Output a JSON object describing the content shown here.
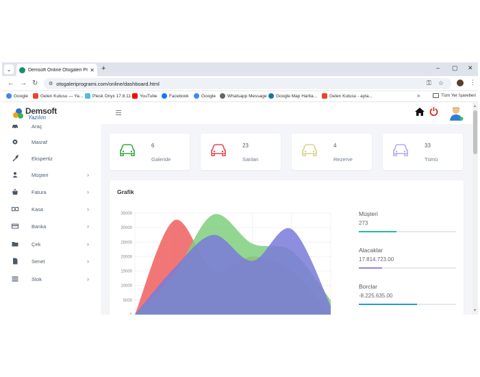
{
  "browser": {
    "tab_title": "Demsoft Online Otogaleri Programı",
    "new_tab": "+",
    "url": "otogaleriprogrami.com/online/dashboard.html",
    "minimize": "–",
    "restore": "▢",
    "close": "✕"
  },
  "bookmarks": [
    {
      "label": "Google",
      "icon": "google-icon",
      "color": "#4285f4"
    },
    {
      "label": "Gelen Kutusu — Ya...",
      "icon": "gmail-icon",
      "color": "#ea4335"
    },
    {
      "label": "Plesk Onyx 17.8.11",
      "icon": "plesk-icon",
      "color": "#52bbe6"
    },
    {
      "label": "YouTube",
      "icon": "youtube-icon",
      "color": "#ff0000"
    },
    {
      "label": "Facebook",
      "icon": "facebook-icon",
      "color": "#1877f2"
    },
    {
      "label": "Google",
      "icon": "google-icon",
      "color": "#4285f4"
    },
    {
      "label": "Whatsapp Message",
      "icon": "globe-icon",
      "color": "#666666"
    },
    {
      "label": "Google Map Harita...",
      "icon": "wordpress-icon",
      "color": "#21759b"
    },
    {
      "label": "Gelen Kutusu - ayta...",
      "icon": "gmail-icon",
      "color": "#ea4335"
    }
  ],
  "bookmarks_more": "»",
  "bookmarks_all": "Tüm Yer İşaretleri",
  "logo": {
    "line1": "Demsoft",
    "line2": "Yazılım"
  },
  "sidebar": {
    "items": [
      {
        "label": "Araç",
        "icon": "car-icon",
        "chevron": false
      },
      {
        "label": "Masraf",
        "icon": "gear-icon",
        "chevron": false
      },
      {
        "label": "Ekspertiz",
        "icon": "wrench-icon",
        "chevron": false
      },
      {
        "label": "Müşteri",
        "icon": "user-icon",
        "chevron": true
      },
      {
        "label": "Fatura",
        "icon": "basket-icon",
        "chevron": true
      },
      {
        "label": "Kasa",
        "icon": "money-icon",
        "chevron": true
      },
      {
        "label": "Banka",
        "icon": "card-icon",
        "chevron": true
      },
      {
        "label": "Çek",
        "icon": "folder-icon",
        "chevron": true
      },
      {
        "label": "Senet",
        "icon": "file-icon",
        "chevron": true
      },
      {
        "label": "Stok",
        "icon": "list-icon",
        "chevron": true
      }
    ]
  },
  "stats": [
    {
      "value": "6",
      "label": "Galeride",
      "color": "#3aa84a"
    },
    {
      "value": "23",
      "label": "Satılan",
      "color": "#e5484d"
    },
    {
      "value": "4",
      "label": "Rezerve",
      "color": "#d7d48a"
    },
    {
      "value": "33",
      "label": "Tümü",
      "color": "#b7a8ee"
    }
  ],
  "grafik": {
    "title": "Grafik"
  },
  "summary": [
    {
      "label": "Müşteri",
      "value": "273",
      "fill": 0.39,
      "color": "#1abc9c"
    },
    {
      "label": "Alacaklar",
      "value": "17.814.723.00",
      "fill": 0.24,
      "color": "#9b7fe6"
    },
    {
      "label": "Borclar",
      "value": "-8.225.635.00",
      "fill": 0.6,
      "color": "#1a9bd7"
    }
  ],
  "chart_data": {
    "type": "area",
    "yticks": [
      "35000",
      "30000",
      "25000",
      "20000",
      "15000",
      "10000",
      "5000",
      "0"
    ],
    "ylim": [
      0,
      35000
    ],
    "x": [
      0,
      1,
      2,
      3,
      4,
      5
    ],
    "series": [
      {
        "values": [
          0,
          32500,
          15000,
          20000,
          15000,
          0
        ],
        "color": "#ef5f5f"
      },
      {
        "values": [
          0,
          14000,
          34500,
          24500,
          22000,
          5000
        ],
        "color": "#7fcf7f"
      },
      {
        "values": [
          0,
          16000,
          27500,
          18500,
          29500,
          3000
        ],
        "color": "#7a7ad8"
      }
    ],
    "grid": true
  }
}
